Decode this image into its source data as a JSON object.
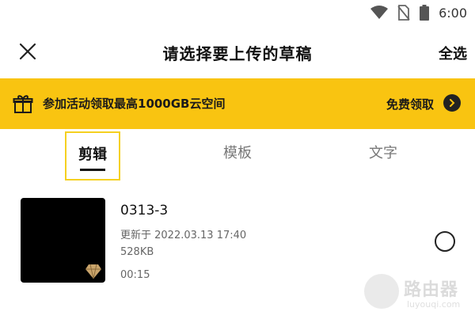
{
  "status": {
    "time": "6:00",
    "icons": [
      "wifi-icon",
      "no-sim-icon",
      "battery-icon"
    ]
  },
  "header": {
    "title": "请选择要上传的草稿",
    "select_all": "全选",
    "close_icon": "close-icon"
  },
  "promo": {
    "text": "参加活动领取最高1000GB云空间",
    "claim": "免费领取",
    "bg_color": "#f9c411"
  },
  "tabs": [
    {
      "label": "剪辑",
      "active": true
    },
    {
      "label": "模板",
      "active": false
    },
    {
      "label": "文字",
      "active": false
    }
  ],
  "drafts": [
    {
      "name": "0313-3",
      "updated": "更新于 2022.03.13 17:40",
      "size": "528KB",
      "duration": "00:15",
      "selected": false
    }
  ],
  "watermark": {
    "text": "路由器",
    "sub": "luyouqi.com"
  }
}
